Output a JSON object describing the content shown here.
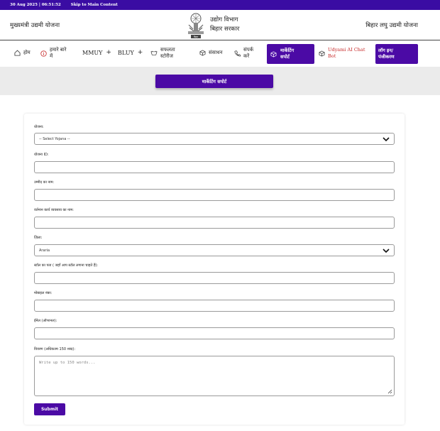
{
  "topbar": {
    "date": "30 Aug 2025 | 06:51:52",
    "skip_link": "Skip to Main Content"
  },
  "header": {
    "left_title": "मुख्यमंत्री उद्यमी योजना",
    "center_line1": "उद्योग विभाग",
    "center_line2": "बिहार सरकार",
    "emblem_text": "बिहार",
    "right_title": "बिहार लघु उद्यमी योजना"
  },
  "nav": {
    "home": "होम",
    "about_line1": "हमारे बारे",
    "about_line2": "में",
    "mmuy": "MMUY",
    "bluy": "BLUY",
    "success_line1": "सफलता",
    "success_line2": "स्टोरीज",
    "resources": "संसाधन",
    "contact_line1": "संपर्क",
    "contact_line2": "करें",
    "marketing_line1": "मार्केटिंग",
    "marketing_line2": "सपोर्ट",
    "chatbot_line1": "Udyami AI Chat",
    "chatbot_line2": "Bot",
    "login_line1": "लॉग इन/",
    "login_line2": "पंजीकरण",
    "plus": "+"
  },
  "band": {
    "button_label": "मार्केटिंग सपोर्ट"
  },
  "form": {
    "yojana_label": "योजना:",
    "yojana_value": "-- Select Yojana --",
    "yojana_id_label": "योजना ID:",
    "name_label": "उम्मीद का नाम:",
    "business_label": "वर्तमान कार्य व्यवसाय का नाम:",
    "district_label": "ज़िला:",
    "district_value": "Araria",
    "stall_label": "स्टॉल का पता ( जहाँ आप स्टॉल लगाना चाहते हैं):",
    "mobile_label": "मोबाइल नंबर:",
    "email_label": "ईमेल (ऑप्शनल):",
    "desc_label": "विवरण (अधिकतम 150 शब्द):",
    "desc_placeholder": "Write up to 150 words...",
    "submit_label": "Submit"
  },
  "colors": {
    "brand": "#4b0aa5",
    "topbar": "#3a0ca3"
  }
}
